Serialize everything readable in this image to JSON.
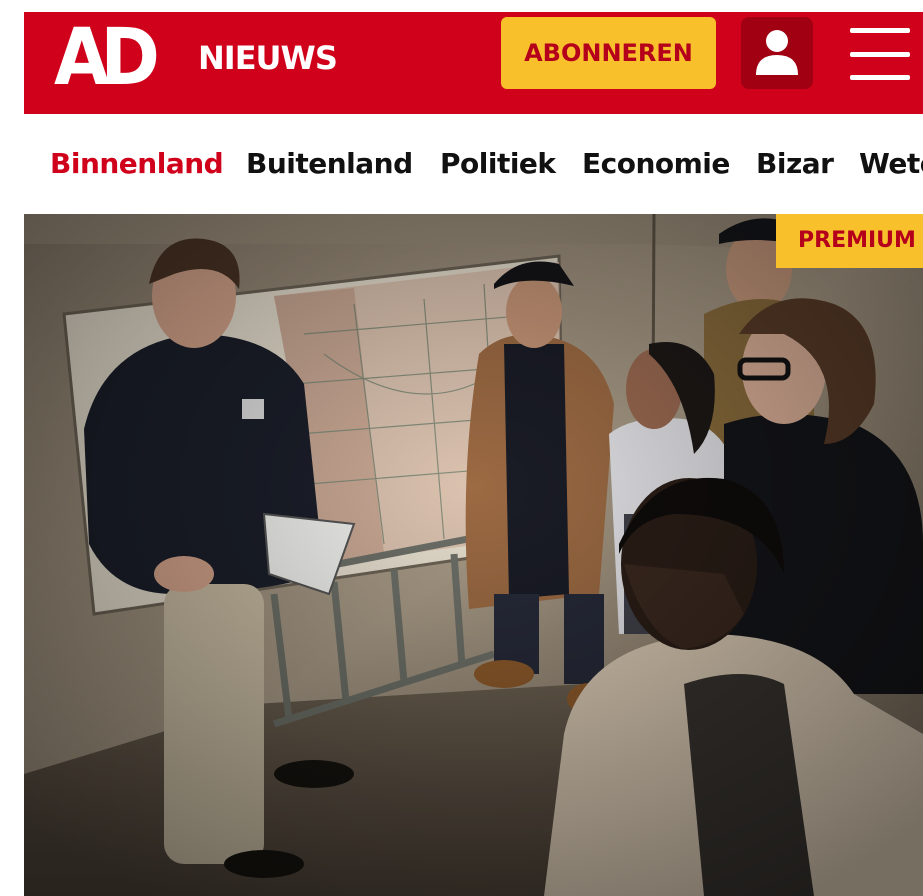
{
  "header": {
    "logo_text": "AD",
    "section_label": "NIEUWS",
    "subscribe_label": "ABONNEREN",
    "brand_color": "#d0021b",
    "accent_color": "#f8c12c",
    "user_icon": "user-icon",
    "menu_icon": "hamburger-menu-icon"
  },
  "nav": {
    "items": [
      {
        "label": "Binnenland",
        "active": true
      },
      {
        "label": "Buitenland"
      },
      {
        "label": "Politiek"
      },
      {
        "label": "Economie"
      },
      {
        "label": "Bizar"
      },
      {
        "label": "Wete"
      }
    ]
  },
  "article": {
    "badge": "PREMIUM"
  }
}
